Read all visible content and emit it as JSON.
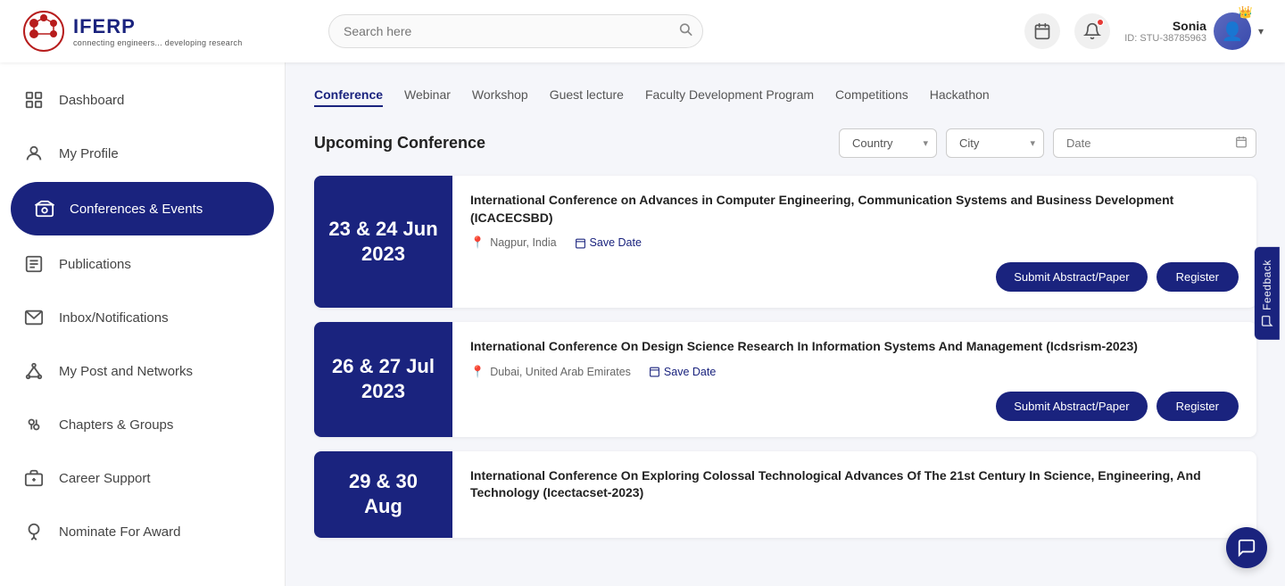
{
  "header": {
    "logo_main": "IFERP",
    "logo_sub": "connecting engineers... developing research",
    "search_placeholder": "Search here",
    "user_name": "Sonia",
    "user_id": "ID: STU-38785963"
  },
  "sidebar": {
    "items": [
      {
        "id": "dashboard",
        "label": "Dashboard",
        "icon": "⊞",
        "active": false
      },
      {
        "id": "my-profile",
        "label": "My Profile",
        "icon": "👤",
        "active": false
      },
      {
        "id": "conferences-events",
        "label": "Conferences & Events",
        "icon": "🎪",
        "active": true
      },
      {
        "id": "publications",
        "label": "Publications",
        "icon": "📰",
        "active": false
      },
      {
        "id": "inbox-notifications",
        "label": "Inbox/Notifications",
        "icon": "📧",
        "active": false
      },
      {
        "id": "my-post-networks",
        "label": "My Post and Networks",
        "icon": "🔗",
        "active": false
      },
      {
        "id": "chapters-groups",
        "label": "Chapters & Groups",
        "icon": "👥",
        "active": false
      },
      {
        "id": "career-support",
        "label": "Career Support",
        "icon": "💼",
        "active": false
      },
      {
        "id": "nominate-award",
        "label": "Nominate For Award",
        "icon": "🏆",
        "active": false
      }
    ]
  },
  "tabs": [
    {
      "id": "conference",
      "label": "Conference",
      "active": true
    },
    {
      "id": "webinar",
      "label": "Webinar",
      "active": false
    },
    {
      "id": "workshop",
      "label": "Workshop",
      "active": false
    },
    {
      "id": "guest-lecture",
      "label": "Guest lecture",
      "active": false
    },
    {
      "id": "faculty-dev",
      "label": "Faculty Development Program",
      "active": false
    },
    {
      "id": "competitions",
      "label": "Competitions",
      "active": false
    },
    {
      "id": "hackathon",
      "label": "Hackathon",
      "active": false
    }
  ],
  "section": {
    "title": "Upcoming Conference",
    "country_placeholder": "Country",
    "city_placeholder": "City",
    "date_placeholder": "Date"
  },
  "conferences": [
    {
      "date": "23 & 24 Jun\n2023",
      "date_line1": "23 & 24 Jun",
      "date_line2": "2023",
      "title": "International Conference on Advances in Computer Engineering, Communication Systems and Business Development (ICACECSBD)",
      "location": "Nagpur, India",
      "save_date": "Save Date",
      "submit_label": "Submit Abstract/Paper",
      "register_label": "Register"
    },
    {
      "date_line1": "26 & 27 Jul",
      "date_line2": "2023",
      "title": "International Conference On Design Science Research In Information Systems And Management (Icdsrism-2023)",
      "location": "Dubai, United Arab Emirates",
      "save_date": "Save Date",
      "submit_label": "Submit Abstract/Paper",
      "register_label": "Register"
    },
    {
      "date_line1": "29 & 30 Aug",
      "date_line2": "",
      "title": "International Conference On Exploring Colossal Technological Advances Of The 21st Century In Science, Engineering, And Technology (Icectacset-2023)",
      "location": "",
      "save_date": "",
      "submit_label": "",
      "register_label": ""
    }
  ],
  "feedback": {
    "label": "Feedback"
  },
  "chat": {
    "icon": "💬"
  }
}
